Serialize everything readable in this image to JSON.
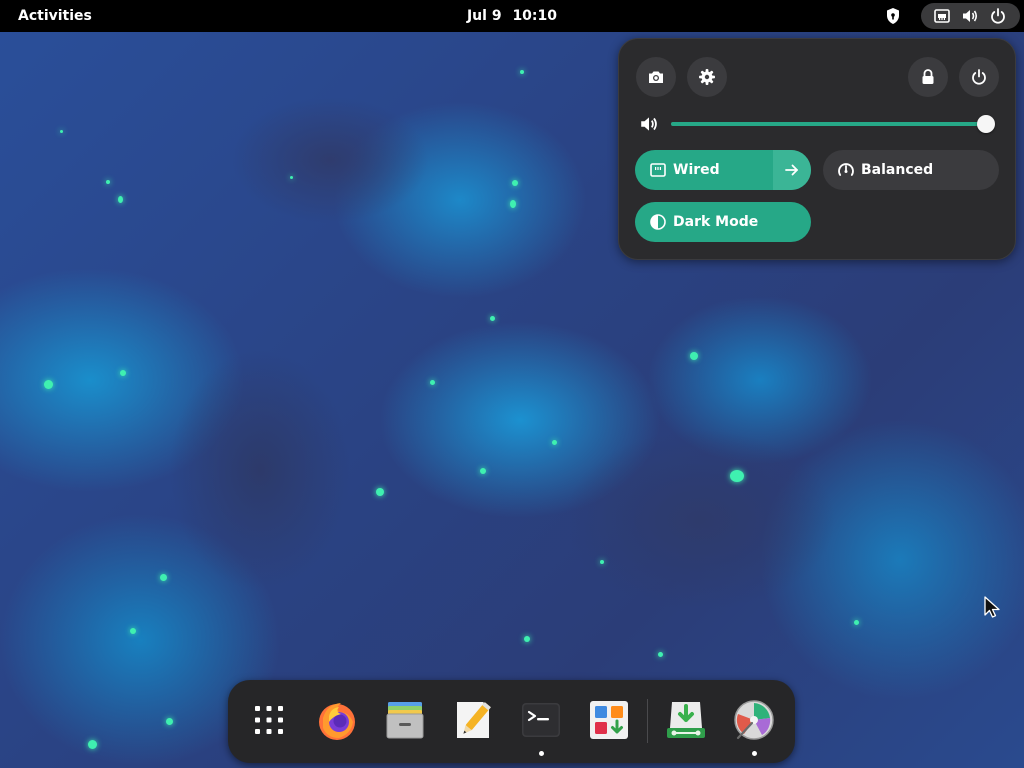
{
  "topbar": {
    "activities_label": "Activities",
    "date": "Jul 9",
    "time": "10:10",
    "status_icons": [
      "privacy-shield-icon",
      "wired-network-icon",
      "volume-icon",
      "power-icon"
    ]
  },
  "quick_settings": {
    "top_buttons": [
      "screenshot-icon",
      "settings-icon",
      "lock-icon",
      "power-icon"
    ],
    "volume": {
      "icon": "volume-high-icon",
      "level": 1.0
    },
    "toggles": {
      "wired": {
        "label": "Wired",
        "state": "on",
        "icon": "ethernet-icon",
        "has_submenu": true
      },
      "power_mode": {
        "label": "Balanced",
        "state": "off",
        "icon": "speedometer-icon"
      },
      "dark_mode": {
        "label": "Dark Mode",
        "state": "on",
        "icon": "dark-mode-icon"
      }
    },
    "accent_color": "#26a887"
  },
  "dock": {
    "items": [
      {
        "name": "show-apps",
        "icon": "app-grid-icon",
        "running": false
      },
      {
        "name": "firefox",
        "icon": "firefox-icon",
        "running": false
      },
      {
        "name": "files",
        "icon": "files-icon",
        "running": false
      },
      {
        "name": "text-editor",
        "icon": "text-editor-icon",
        "running": false
      },
      {
        "name": "terminal",
        "icon": "terminal-icon",
        "running": true
      },
      {
        "name": "software",
        "icon": "software-store-icon",
        "running": false
      },
      {
        "name": "installer",
        "icon": "installer-icon",
        "running": false
      },
      {
        "name": "disk-usage",
        "icon": "disk-usage-icon",
        "running": true
      }
    ]
  }
}
